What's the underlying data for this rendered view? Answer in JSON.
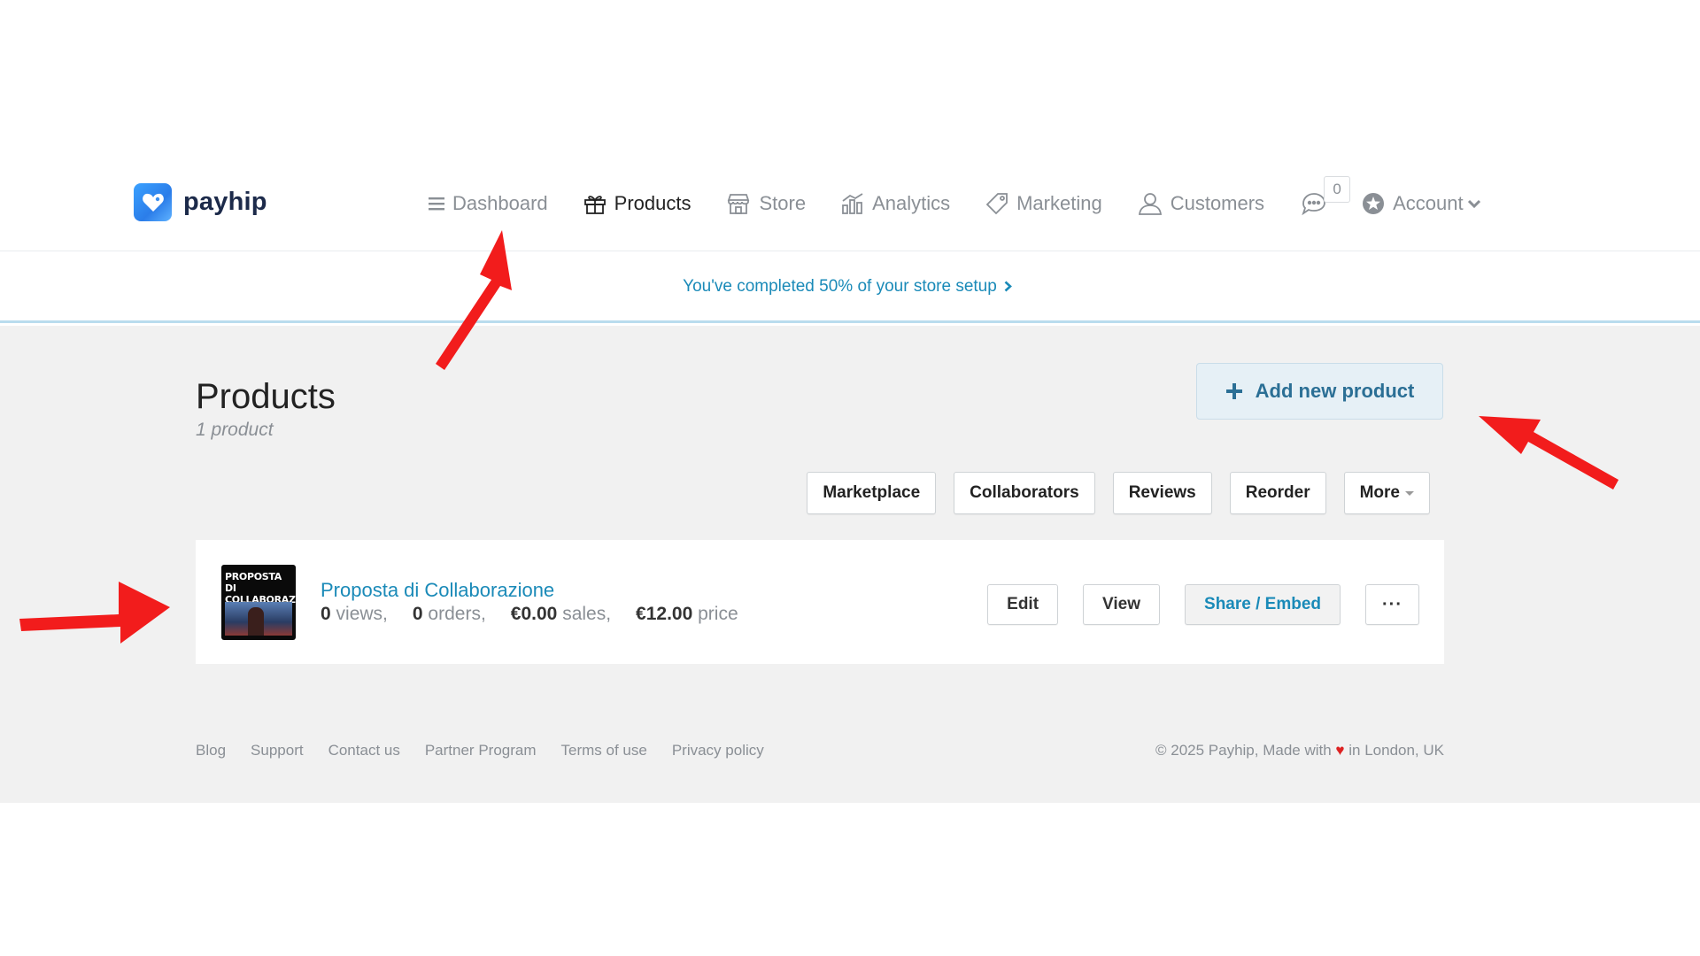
{
  "brand": {
    "name": "payhip"
  },
  "nav": {
    "items": [
      {
        "label": "Dashboard",
        "icon": "list-icon"
      },
      {
        "label": "Products",
        "icon": "gift-icon",
        "active": true
      },
      {
        "label": "Store",
        "icon": "store-icon"
      },
      {
        "label": "Analytics",
        "icon": "bar-chart-icon"
      },
      {
        "label": "Marketing",
        "icon": "tag-icon"
      },
      {
        "label": "Customers",
        "icon": "user-icon"
      }
    ],
    "messages_count": "0",
    "account_label": "Account"
  },
  "setup": {
    "text": "You've completed 50% of your store setup"
  },
  "page": {
    "title": "Products",
    "subtitle": "1 product",
    "add_button": "Add new product"
  },
  "filters": [
    "Marketplace",
    "Collaborators",
    "Reviews",
    "Reorder",
    "More"
  ],
  "product": {
    "thumb_text": "PROPOSTA DI COLLABORAZIONE",
    "name": "Proposta di Collaborazione",
    "views_value": "0",
    "views_label": "views,",
    "orders_value": "0",
    "orders_label": "orders,",
    "sales_value": "€0.00",
    "sales_label": "sales,",
    "price_value": "€12.00",
    "price_label": "price",
    "actions": {
      "edit": "Edit",
      "view": "View",
      "share": "Share / Embed",
      "more": "···"
    }
  },
  "footer": {
    "links": [
      "Blog",
      "Support",
      "Contact us",
      "Partner Program",
      "Terms of use",
      "Privacy policy"
    ],
    "copyright_before": "© 2025 Payhip, Made with",
    "heart": "♥",
    "copyright_after": "in London, UK"
  },
  "colors": {
    "link": "#1a8ab8",
    "annotation_arrow": "#f21c1c",
    "logo": "#2b7de9"
  }
}
